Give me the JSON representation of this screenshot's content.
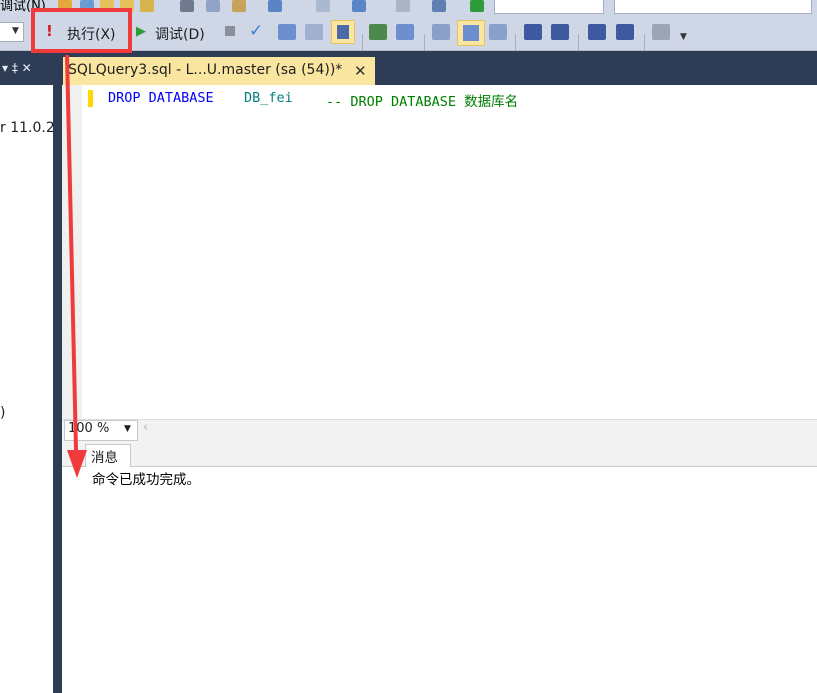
{
  "menu": {
    "fragment": "调试(N)"
  },
  "toolbar": {
    "execute_label": "执行(X)",
    "debug_label": "调试(D)"
  },
  "left_panel": {
    "pin_glyph": "▾ ‡ ✕",
    "version_fragment": "r 11.0.2",
    "paren_fragment": ")"
  },
  "document": {
    "tab_title": "SQLQuery3.sql - L...U.master (sa (54))*",
    "close_glyph": "✕"
  },
  "editor": {
    "code_kw1": "DROP DATABASE",
    "code_ident": "DB_fei",
    "code_comment": "-- DROP DATABASE 数据库名"
  },
  "statusbar": {
    "zoom": "100 %"
  },
  "results": {
    "tab_label": "消息",
    "message": "命令已成功完成。"
  },
  "colors": {
    "chrome": "#2f3c56",
    "toolbar": "#cfd6e5",
    "active_tab": "#fbe6a1",
    "highlight": "#ef3b3b"
  }
}
